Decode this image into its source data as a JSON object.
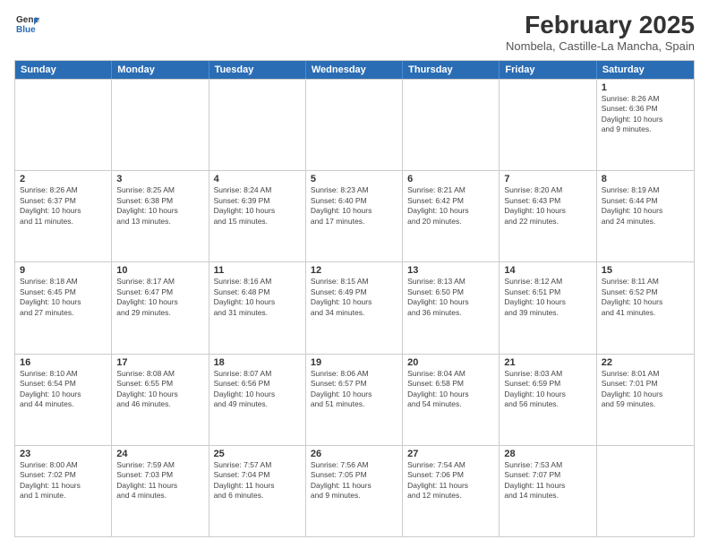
{
  "header": {
    "logo_line1": "General",
    "logo_line2": "Blue",
    "month": "February 2025",
    "location": "Nombela, Castille-La Mancha, Spain"
  },
  "weekdays": [
    "Sunday",
    "Monday",
    "Tuesday",
    "Wednesday",
    "Thursday",
    "Friday",
    "Saturday"
  ],
  "rows": [
    [
      {
        "day": "",
        "info": ""
      },
      {
        "day": "",
        "info": ""
      },
      {
        "day": "",
        "info": ""
      },
      {
        "day": "",
        "info": ""
      },
      {
        "day": "",
        "info": ""
      },
      {
        "day": "",
        "info": ""
      },
      {
        "day": "1",
        "info": "Sunrise: 8:26 AM\nSunset: 6:36 PM\nDaylight: 10 hours\nand 9 minutes."
      }
    ],
    [
      {
        "day": "2",
        "info": "Sunrise: 8:26 AM\nSunset: 6:37 PM\nDaylight: 10 hours\nand 11 minutes."
      },
      {
        "day": "3",
        "info": "Sunrise: 8:25 AM\nSunset: 6:38 PM\nDaylight: 10 hours\nand 13 minutes."
      },
      {
        "day": "4",
        "info": "Sunrise: 8:24 AM\nSunset: 6:39 PM\nDaylight: 10 hours\nand 15 minutes."
      },
      {
        "day": "5",
        "info": "Sunrise: 8:23 AM\nSunset: 6:40 PM\nDaylight: 10 hours\nand 17 minutes."
      },
      {
        "day": "6",
        "info": "Sunrise: 8:21 AM\nSunset: 6:42 PM\nDaylight: 10 hours\nand 20 minutes."
      },
      {
        "day": "7",
        "info": "Sunrise: 8:20 AM\nSunset: 6:43 PM\nDaylight: 10 hours\nand 22 minutes."
      },
      {
        "day": "8",
        "info": "Sunrise: 8:19 AM\nSunset: 6:44 PM\nDaylight: 10 hours\nand 24 minutes."
      }
    ],
    [
      {
        "day": "9",
        "info": "Sunrise: 8:18 AM\nSunset: 6:45 PM\nDaylight: 10 hours\nand 27 minutes."
      },
      {
        "day": "10",
        "info": "Sunrise: 8:17 AM\nSunset: 6:47 PM\nDaylight: 10 hours\nand 29 minutes."
      },
      {
        "day": "11",
        "info": "Sunrise: 8:16 AM\nSunset: 6:48 PM\nDaylight: 10 hours\nand 31 minutes."
      },
      {
        "day": "12",
        "info": "Sunrise: 8:15 AM\nSunset: 6:49 PM\nDaylight: 10 hours\nand 34 minutes."
      },
      {
        "day": "13",
        "info": "Sunrise: 8:13 AM\nSunset: 6:50 PM\nDaylight: 10 hours\nand 36 minutes."
      },
      {
        "day": "14",
        "info": "Sunrise: 8:12 AM\nSunset: 6:51 PM\nDaylight: 10 hours\nand 39 minutes."
      },
      {
        "day": "15",
        "info": "Sunrise: 8:11 AM\nSunset: 6:52 PM\nDaylight: 10 hours\nand 41 minutes."
      }
    ],
    [
      {
        "day": "16",
        "info": "Sunrise: 8:10 AM\nSunset: 6:54 PM\nDaylight: 10 hours\nand 44 minutes."
      },
      {
        "day": "17",
        "info": "Sunrise: 8:08 AM\nSunset: 6:55 PM\nDaylight: 10 hours\nand 46 minutes."
      },
      {
        "day": "18",
        "info": "Sunrise: 8:07 AM\nSunset: 6:56 PM\nDaylight: 10 hours\nand 49 minutes."
      },
      {
        "day": "19",
        "info": "Sunrise: 8:06 AM\nSunset: 6:57 PM\nDaylight: 10 hours\nand 51 minutes."
      },
      {
        "day": "20",
        "info": "Sunrise: 8:04 AM\nSunset: 6:58 PM\nDaylight: 10 hours\nand 54 minutes."
      },
      {
        "day": "21",
        "info": "Sunrise: 8:03 AM\nSunset: 6:59 PM\nDaylight: 10 hours\nand 56 minutes."
      },
      {
        "day": "22",
        "info": "Sunrise: 8:01 AM\nSunset: 7:01 PM\nDaylight: 10 hours\nand 59 minutes."
      }
    ],
    [
      {
        "day": "23",
        "info": "Sunrise: 8:00 AM\nSunset: 7:02 PM\nDaylight: 11 hours\nand 1 minute."
      },
      {
        "day": "24",
        "info": "Sunrise: 7:59 AM\nSunset: 7:03 PM\nDaylight: 11 hours\nand 4 minutes."
      },
      {
        "day": "25",
        "info": "Sunrise: 7:57 AM\nSunset: 7:04 PM\nDaylight: 11 hours\nand 6 minutes."
      },
      {
        "day": "26",
        "info": "Sunrise: 7:56 AM\nSunset: 7:05 PM\nDaylight: 11 hours\nand 9 minutes."
      },
      {
        "day": "27",
        "info": "Sunrise: 7:54 AM\nSunset: 7:06 PM\nDaylight: 11 hours\nand 12 minutes."
      },
      {
        "day": "28",
        "info": "Sunrise: 7:53 AM\nSunset: 7:07 PM\nDaylight: 11 hours\nand 14 minutes."
      },
      {
        "day": "",
        "info": ""
      }
    ]
  ]
}
